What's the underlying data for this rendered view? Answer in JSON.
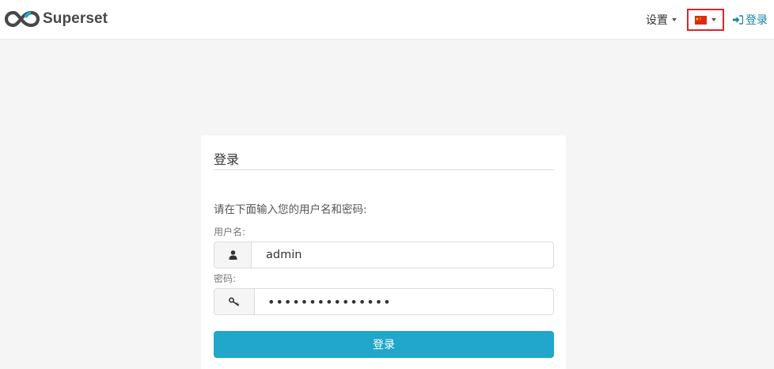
{
  "navbar": {
    "brand_name": "Superset",
    "settings_label": "设置",
    "language_flag_icon": "china-flag-icon",
    "login_label": "登录",
    "login_icon": "sign-in-icon",
    "brand_color": "#484848",
    "link_color": "#1a85a0",
    "highlight_border_color": "#d9262b"
  },
  "login_panel": {
    "title": "登录",
    "instructions": "请在下面输入您的用户名和密码:",
    "username_label": "用户名:",
    "username_value": "admin",
    "username_icon": "user-icon",
    "password_label": "密码:",
    "password_value": "•••••••••••••••",
    "password_icon": "key-icon",
    "submit_label": "登录",
    "submit_color": "#20a7c9"
  }
}
